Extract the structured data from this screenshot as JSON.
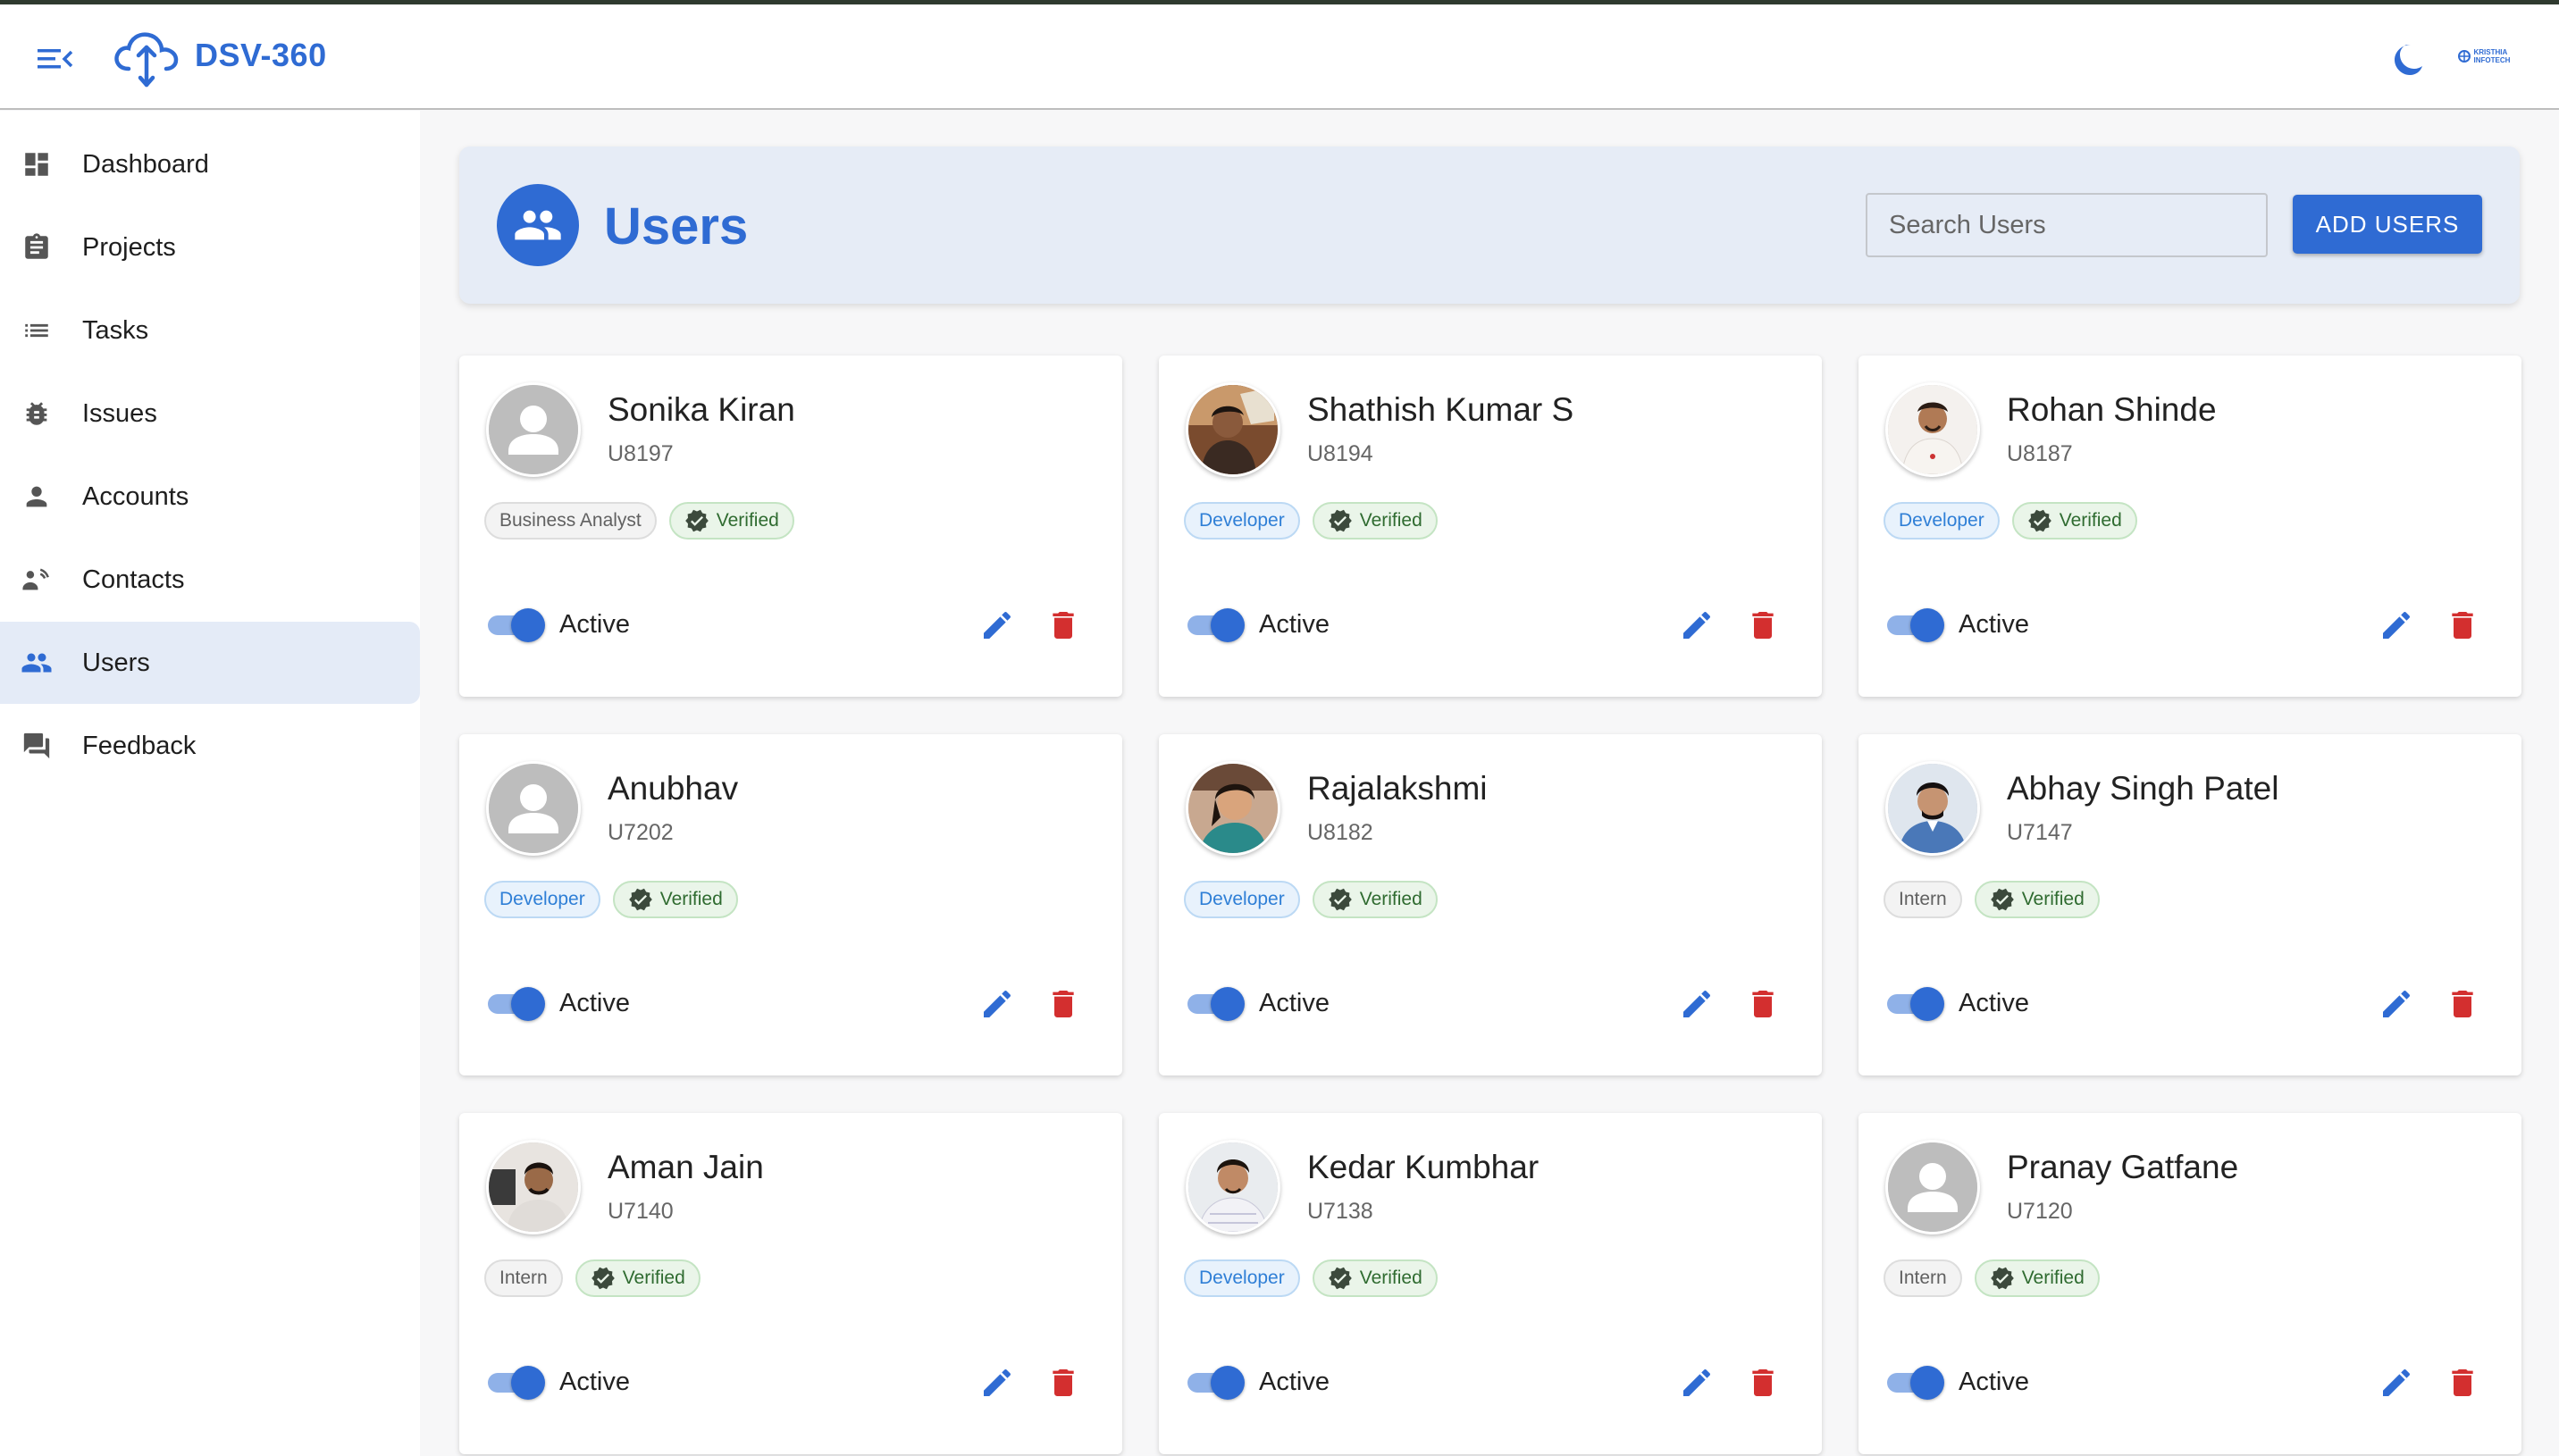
{
  "app": {
    "brand": "DSV-360"
  },
  "org_logo_text": "KRISTHIA INFOTECH",
  "sidebar": {
    "items": [
      {
        "label": "Dashboard",
        "icon": "dashboard-icon"
      },
      {
        "label": "Projects",
        "icon": "clipboard-icon"
      },
      {
        "label": "Tasks",
        "icon": "list-icon"
      },
      {
        "label": "Issues",
        "icon": "bug-icon"
      },
      {
        "label": "Accounts",
        "icon": "person-icon"
      },
      {
        "label": "Contacts",
        "icon": "contact-phone-icon"
      },
      {
        "label": "Users",
        "icon": "people-icon",
        "active": true
      },
      {
        "label": "Feedback",
        "icon": "feedback-icon"
      }
    ]
  },
  "header": {
    "title": "Users",
    "search_placeholder": "Search Users",
    "add_button": "ADD USERS"
  },
  "users": [
    {
      "name": "Sonika Kiran",
      "id": "U8197",
      "role": "Business Analyst",
      "role_style": "gray",
      "verified": "Verified",
      "status": "Active",
      "avatar": "placeholder"
    },
    {
      "name": "Shathish Kumar S",
      "id": "U8194",
      "role": "Developer",
      "role_style": "blue",
      "verified": "Verified",
      "status": "Active",
      "avatar": "photo"
    },
    {
      "name": "Rohan Shinde",
      "id": "U8187",
      "role": "Developer",
      "role_style": "blue",
      "verified": "Verified",
      "status": "Active",
      "avatar": "photo"
    },
    {
      "name": "Anubhav",
      "id": "U7202",
      "role": "Developer",
      "role_style": "blue",
      "verified": "Verified",
      "status": "Active",
      "avatar": "placeholder"
    },
    {
      "name": "Rajalakshmi",
      "id": "U8182",
      "role": "Developer",
      "role_style": "blue",
      "verified": "Verified",
      "status": "Active",
      "avatar": "photo"
    },
    {
      "name": "Abhay Singh Patel",
      "id": "U7147",
      "role": "Intern",
      "role_style": "gray",
      "verified": "Verified",
      "status": "Active",
      "avatar": "photo"
    },
    {
      "name": "Aman Jain",
      "id": "U7140",
      "role": "Intern",
      "role_style": "gray",
      "verified": "Verified",
      "status": "Active",
      "avatar": "photo"
    },
    {
      "name": "Kedar Kumbhar",
      "id": "U7138",
      "role": "Developer",
      "role_style": "blue",
      "verified": "Verified",
      "status": "Active",
      "avatar": "photo"
    },
    {
      "name": "Pranay Gatfane",
      "id": "U7120",
      "role": "Intern",
      "role_style": "gray",
      "verified": "Verified",
      "status": "Active",
      "avatar": "placeholder"
    }
  ],
  "colors": {
    "primary": "#2f6bd3",
    "delete": "#d32f2f",
    "verified": "#2f6b30",
    "active_nav_bg": "#e4ebf7"
  }
}
